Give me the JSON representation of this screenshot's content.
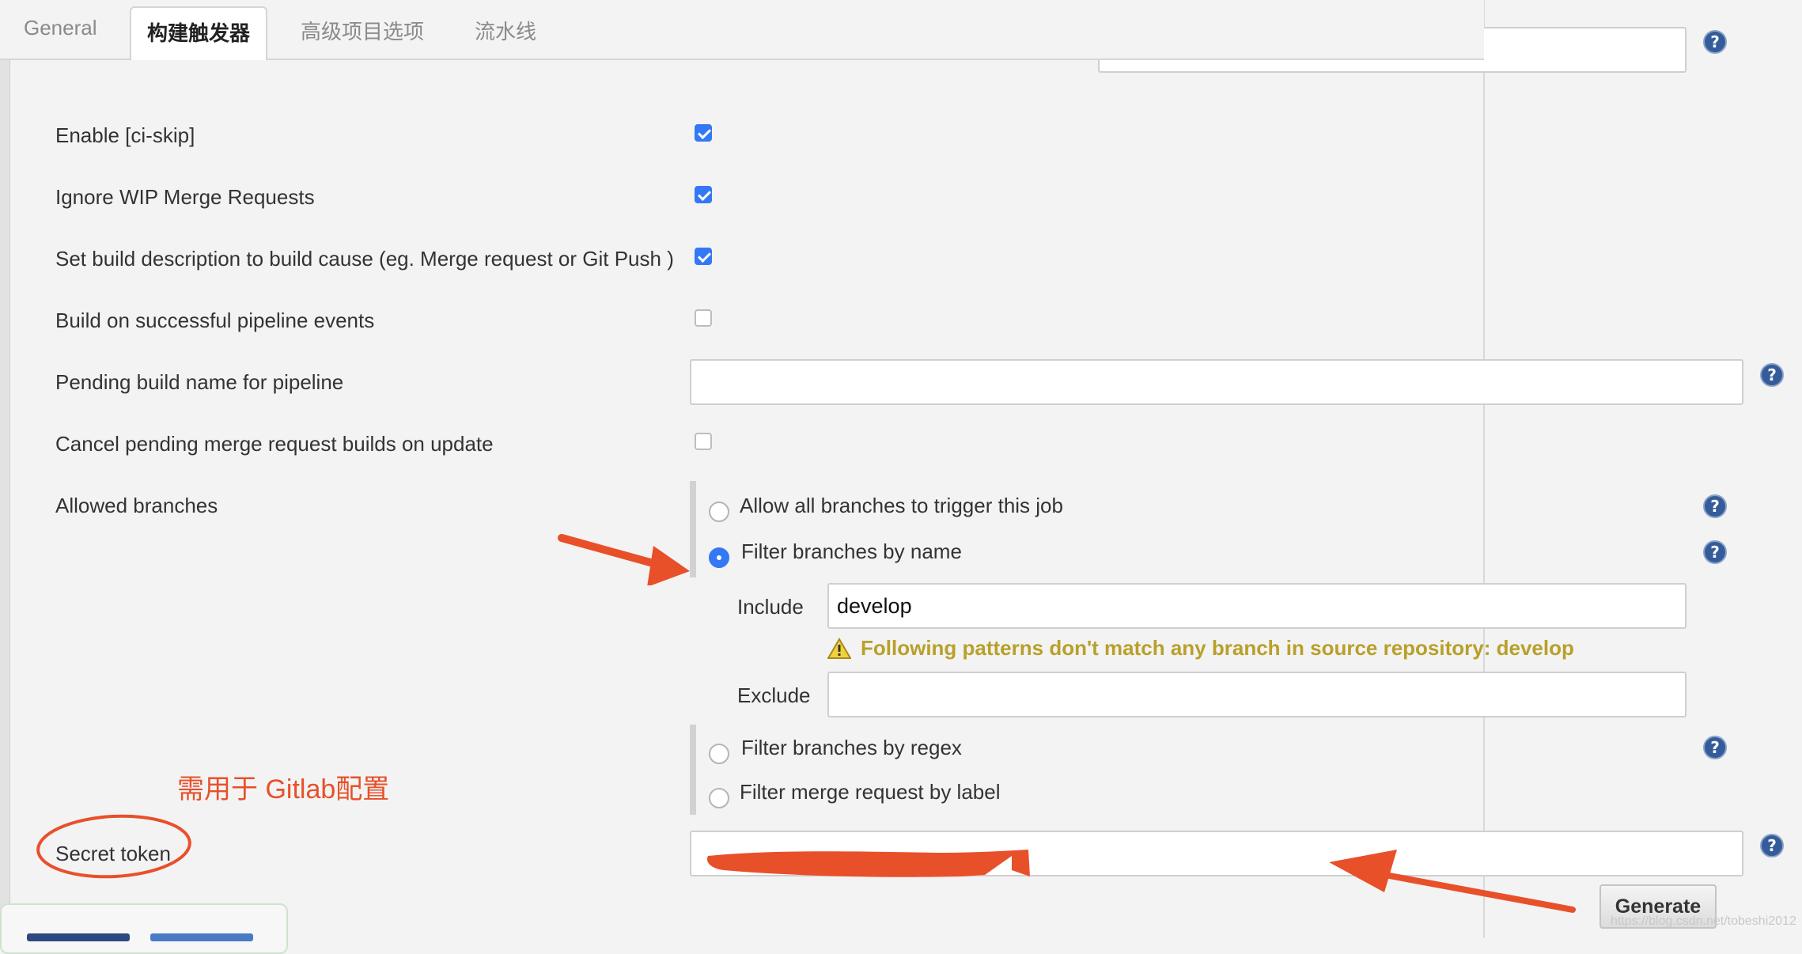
{
  "tabs": [
    {
      "label": "General"
    },
    {
      "label": "构建触发器"
    },
    {
      "label": "高级项目选项"
    },
    {
      "label": "流水线"
    }
  ],
  "options": {
    "ci_skip": {
      "label": "Enable [ci-skip]",
      "checked": true
    },
    "ignore_wip": {
      "label": "Ignore WIP Merge Requests",
      "checked": true
    },
    "set_build_desc": {
      "label": "Set build description to build cause (eg. Merge request or Git Push )",
      "checked": true
    },
    "build_on_pipeline": {
      "label": "Build on successful pipeline events",
      "checked": false
    },
    "pending_build_name": {
      "label": "Pending build name for pipeline",
      "value": ""
    },
    "cancel_pending": {
      "label": "Cancel pending merge request builds on update",
      "checked": false
    }
  },
  "allowed_branches": {
    "label": "Allowed branches",
    "allow_all": "Allow all branches to trigger this job",
    "filter_by_name": "Filter branches by name",
    "include_label": "Include",
    "include_value": "develop",
    "warning": "Following patterns don't match any branch in source repository: develop",
    "exclude_label": "Exclude",
    "exclude_value": "",
    "filter_by_regex": "Filter branches by regex",
    "filter_by_label": "Filter merge request by label"
  },
  "secret_token": {
    "label": "Secret token",
    "generate_label": "Generate"
  },
  "annotation": "需用于 Gitlab配置",
  "watermark": "https://blog.csdn.net/tobeshi2012",
  "colors": {
    "accent": "#3478f6",
    "annotation": "#e8502a",
    "warning": "#b8a02a"
  }
}
